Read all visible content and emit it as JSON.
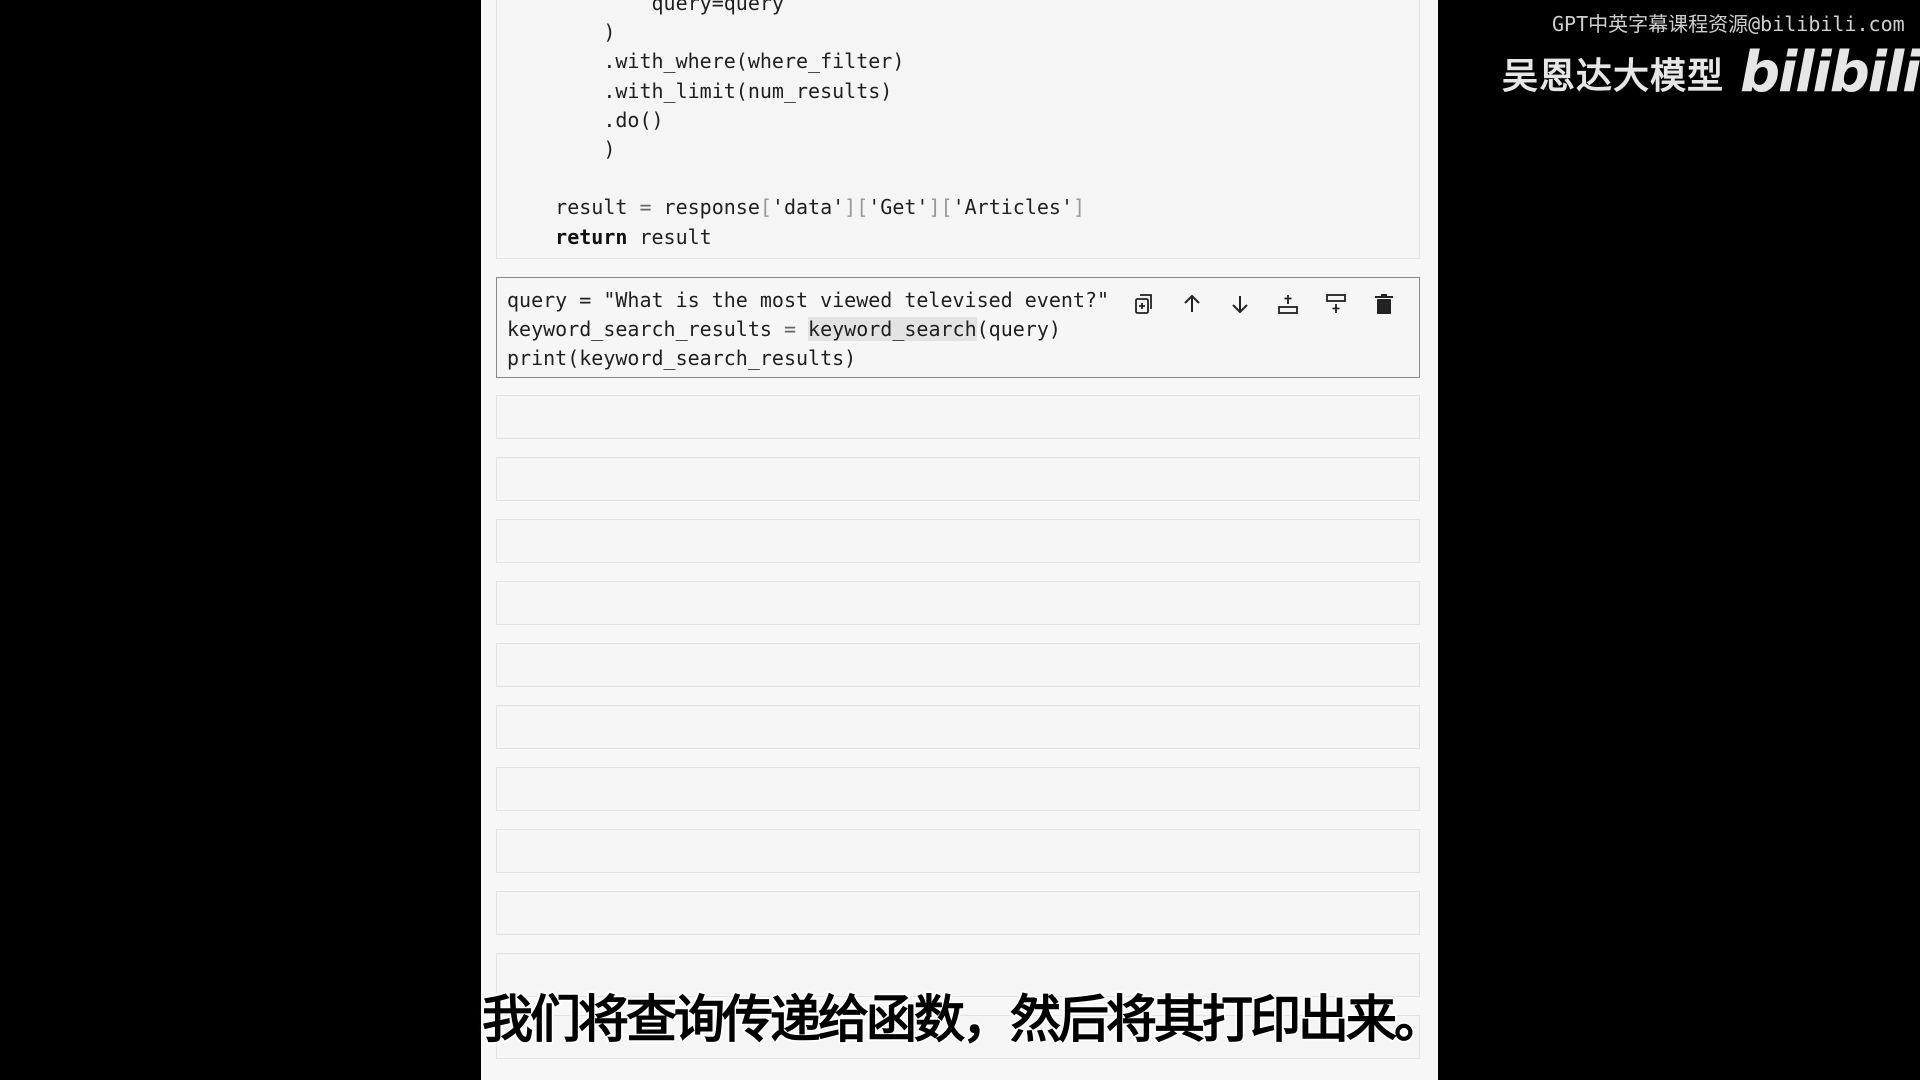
{
  "code_cell_top": {
    "lines": [
      "            query=query",
      "        )",
      "        .with_where(where_filter)",
      "        .with_limit(num_results)",
      "        .do()",
      "        )",
      "",
      "    result = response['data']['Get']['Articles']",
      "    return result"
    ]
  },
  "active_cell": {
    "line1": "query = \"What is the most viewed televised event?\"",
    "line2_var": "keyword_search_results",
    "line2_eq": " = ",
    "line2_fn": "keyword_search",
    "line2_args": "(query)",
    "line3": "print(keyword_search_results)"
  },
  "toolbar": {
    "icons": [
      "duplicate-icon",
      "move-up-icon",
      "move-down-icon",
      "insert-above-icon",
      "insert-below-icon",
      "delete-icon"
    ]
  },
  "empty_cell_count": 11,
  "watermark": {
    "text": "GPT中英字幕课程资源@bilibili.com"
  },
  "brand": {
    "text": "吴恩达大模型",
    "logo": "bilibili"
  },
  "subtitle": {
    "text": "我们将查询传递给函数，然后将其打印出来。"
  }
}
